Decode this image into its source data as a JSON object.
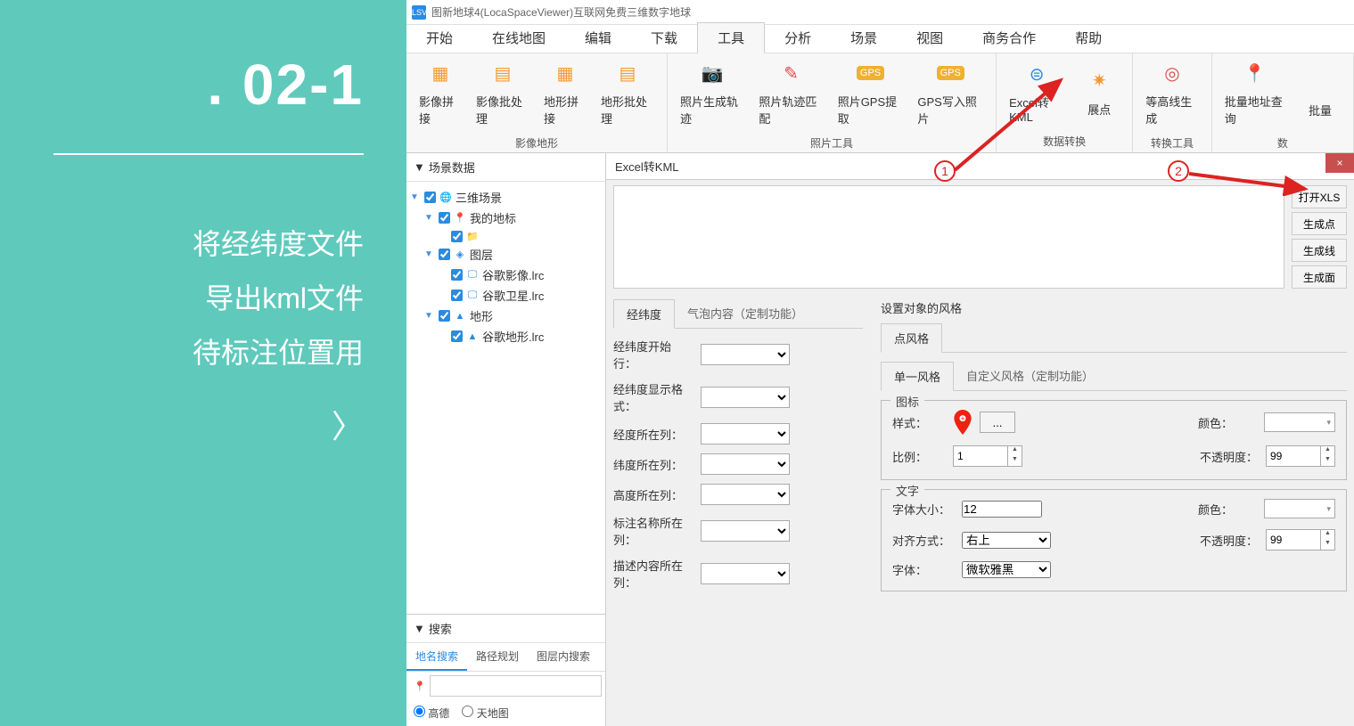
{
  "leftPanel": {
    "title": ". 02-1",
    "lines": [
      "将经纬度文件",
      "导出kml文件",
      "待标注位置用"
    ],
    "chevron": "〉"
  },
  "titlebar": {
    "logo": "LSV",
    "text": "图新地球4(LocaSpaceViewer)互联网免费三维数字地球"
  },
  "menu": {
    "tabs": [
      "开始",
      "在线地图",
      "编辑",
      "下载",
      "工具",
      "分析",
      "场景",
      "视图",
      "商务合作",
      "帮助"
    ],
    "activeIndex": 4
  },
  "ribbon": {
    "groups": [
      {
        "label": "影像地形",
        "items": [
          "影像拼接",
          "影像批处理",
          "地形拼接",
          "地形批处理"
        ]
      },
      {
        "label": "照片工具",
        "items": [
          "照片生成轨迹",
          "照片轨迹匹配",
          "照片GPS提取",
          "GPS写入照片"
        ]
      },
      {
        "label": "数据转换",
        "items": [
          "Excel转KML",
          "展点"
        ]
      },
      {
        "label": "转换工具",
        "items": [
          "等高线生成"
        ]
      },
      {
        "label": "数",
        "items": [
          "批量地址查询",
          "批量"
        ]
      }
    ]
  },
  "scenePanel": {
    "header": "场景数据",
    "nodes": {
      "root": "三维场景",
      "myMark": "我的地标",
      "layers": "图层",
      "googleImg": "谷歌影像.lrc",
      "googleSat": "谷歌卫星.lrc",
      "terrain": "地形",
      "googleTerrain": "谷歌地形.lrc"
    }
  },
  "searchPanel": {
    "header": "搜索",
    "tabs": [
      "地名搜索",
      "路径规划",
      "图层内搜索"
    ],
    "radios": [
      "高德",
      "天地图"
    ]
  },
  "excel": {
    "title": "Excel转KML",
    "close": "×",
    "buttons": [
      "打开XLS",
      "生成点",
      "生成线",
      "生成面"
    ],
    "latlonTabs": [
      "经纬度",
      "气泡内容（定制功能）"
    ],
    "latlonFields": [
      "经纬度开始行：",
      "经纬度显示格式：",
      "经度所在列：",
      "纬度所在列：",
      "高度所在列：",
      "标注名称所在列：",
      "描述内容所在列："
    ],
    "styleHeader": "设置对象的风格",
    "pointTab": "点风格",
    "pointSubTabs": [
      "单一风格",
      "自定义风格（定制功能）"
    ],
    "iconGroup": {
      "title": "图标",
      "styleLabel": "样式：",
      "dots": "...",
      "colorLabel": "颜色：",
      "ratioLabel": "比例：",
      "ratioValue": "1",
      "opacityLabel": "不透明度：",
      "opacityValue": "99"
    },
    "textGroup": {
      "title": "文字",
      "fontSizeLabel": "字体大小：",
      "fontSizeValue": "12",
      "colorLabel": "颜色：",
      "alignLabel": "对齐方式：",
      "alignValue": "右上",
      "opacityLabel": "不透明度：",
      "opacityValue": "99",
      "fontLabel": "字体：",
      "fontValue": "微软雅黑"
    }
  },
  "annotations": {
    "one": "1",
    "two": "2"
  }
}
